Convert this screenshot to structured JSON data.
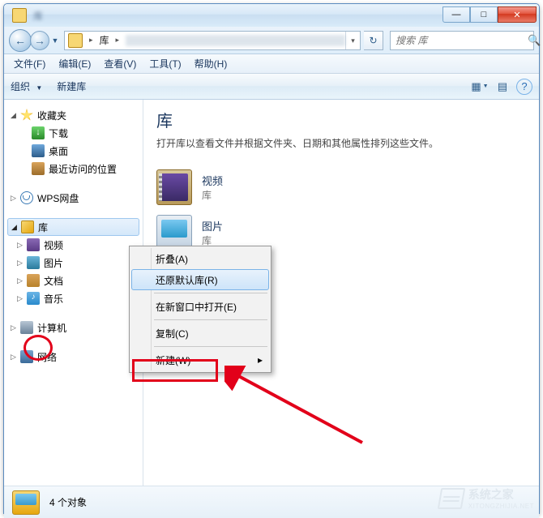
{
  "titlebar": {
    "title": "库"
  },
  "win_buttons": {
    "min": "—",
    "max": "□",
    "close": "✕"
  },
  "nav": {
    "back": "←",
    "fwd": "→",
    "drop": "▼"
  },
  "address": {
    "root": "库",
    "chev": "▸",
    "drop": "▾",
    "refresh": "↻"
  },
  "search": {
    "placeholder": "搜索 库",
    "icon": "🔍"
  },
  "menu": {
    "file": "文件(F)",
    "edit": "编辑(E)",
    "view": "查看(V)",
    "tools": "工具(T)",
    "help": "帮助(H)"
  },
  "cmdbar": {
    "organize": "组织",
    "newlib": "新建库",
    "drop": "▼",
    "help": "?"
  },
  "tree": {
    "favorites": "收藏夹",
    "downloads": "下载",
    "desktop": "桌面",
    "recent": "最近访问的位置",
    "wps": "WPS网盘",
    "libraries": "库",
    "videos": "视频",
    "pictures": "图片",
    "documents": "文档",
    "music": "音乐",
    "computer": "计算机",
    "network": "网络",
    "exp": "◢",
    "expw": "◣",
    "col": "▷"
  },
  "content": {
    "heading": "库",
    "desc": "打开库以查看文件并根据文件夹、日期和其他属性排列这些文件。",
    "items": [
      {
        "name": "视频",
        "type": "库"
      },
      {
        "name": "图片",
        "type": "库"
      }
    ]
  },
  "context_menu": {
    "collapse": "折叠(A)",
    "restore": "还原默认库(R)",
    "new_window": "在新窗口中打开(E)",
    "copy": "复制(C)",
    "new": "新建(W)",
    "arrow": "▸"
  },
  "status": {
    "text": "4 个对象"
  },
  "watermark": {
    "text1": "系统之家",
    "text2": "XITONGZHIJIA.NET"
  }
}
